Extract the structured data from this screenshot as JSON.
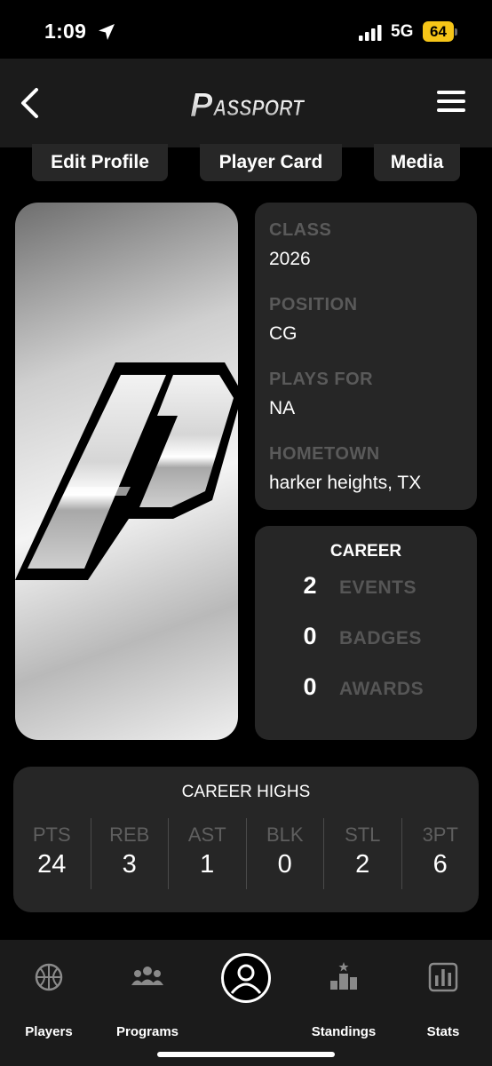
{
  "status_bar": {
    "time": "1:09",
    "network": "5G",
    "battery": "64"
  },
  "header": {
    "logo_text": "PASSPORT"
  },
  "tabs": [
    {
      "label": "Edit Profile"
    },
    {
      "label": "Player Card"
    },
    {
      "label": "Media"
    }
  ],
  "info": {
    "class_label": "CLASS",
    "class_value": "2026",
    "position_label": "POSITION",
    "position_value": "CG",
    "plays_for_label": "PLAYS FOR",
    "plays_for_value": "NA",
    "hometown_label": "HOMETOWN",
    "hometown_value": "harker heights, TX"
  },
  "career": {
    "title": "CAREER",
    "rows": [
      {
        "count": "2",
        "label": "EVENTS"
      },
      {
        "count": "0",
        "label": "BADGES"
      },
      {
        "count": "0",
        "label": "AWARDS"
      }
    ]
  },
  "career_highs": {
    "title": "CAREER HIGHS",
    "stats": [
      {
        "key": "PTS",
        "value": "24"
      },
      {
        "key": "REB",
        "value": "3"
      },
      {
        "key": "AST",
        "value": "1"
      },
      {
        "key": "BLK",
        "value": "0"
      },
      {
        "key": "STL",
        "value": "2"
      },
      {
        "key": "3PT",
        "value": "6"
      }
    ]
  },
  "bottom_nav": [
    {
      "label": "Players",
      "icon": "basketball-icon"
    },
    {
      "label": "Programs",
      "icon": "group-icon"
    },
    {
      "label": "",
      "icon": "profile-icon"
    },
    {
      "label": "Standings",
      "icon": "podium-icon"
    },
    {
      "label": "Stats",
      "icon": "bar-chart-icon"
    }
  ],
  "colors": {
    "accent_battery": "#f5c518",
    "card_bg": "#262626",
    "muted_label": "#5a5a5a"
  }
}
